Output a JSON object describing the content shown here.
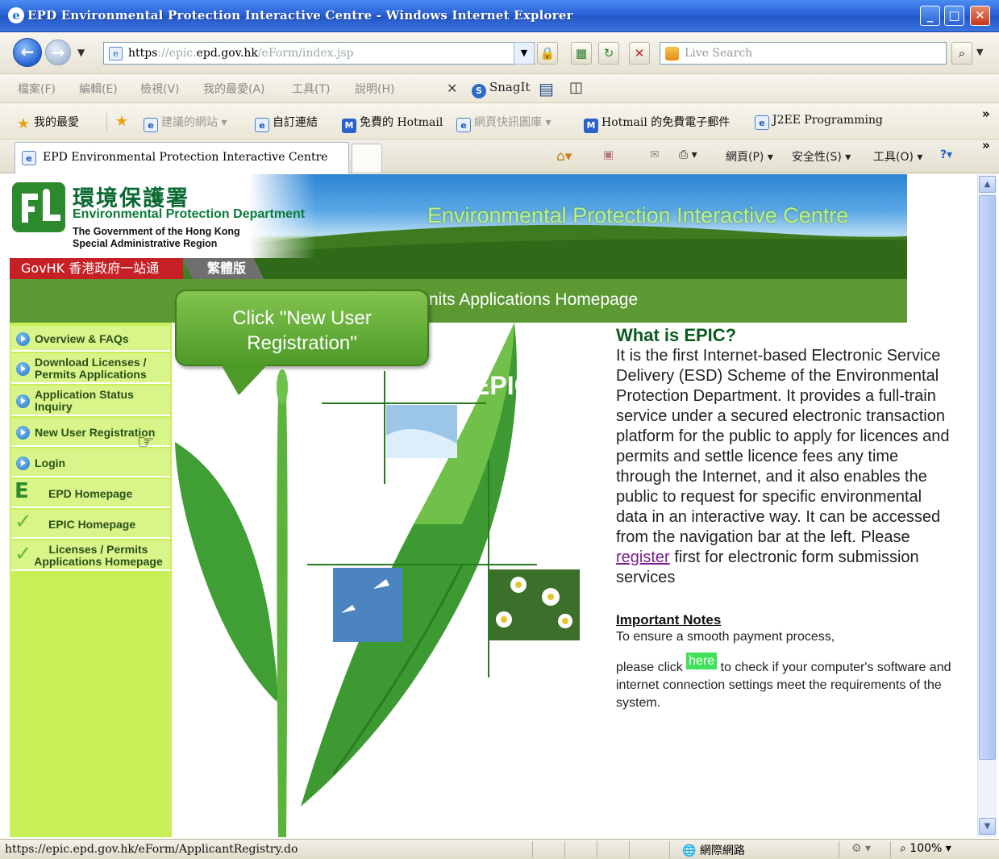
{
  "window": {
    "title": "EPD Environmental Protection Interactive Centre - Windows Internet Explorer"
  },
  "address": {
    "url_scheme": "https",
    "url_host_prefix": "://epic.",
    "url_host": "epd.gov.hk",
    "url_path": "/eForm/index.jsp"
  },
  "search": {
    "placeholder": "Live Search"
  },
  "menu": {
    "items": [
      "檔案(F)",
      "編輯(E)",
      "檢視(V)",
      "我的最愛(A)",
      "工具(T)",
      "說明(H)"
    ],
    "snagit": "SnagIt"
  },
  "favorites": {
    "label": "我的最愛",
    "items": [
      "建議的網站 ▾",
      "自訂連結",
      "免費的 Hotmail",
      "網頁快訊圖庫 ▾",
      "Hotmail 的免費電子郵件",
      "J2EE Programming"
    ]
  },
  "tab": {
    "title": "EPD Environmental Protection Interactive Centre"
  },
  "commandbar": {
    "page": "網頁(P) ▾",
    "safety": "安全性(S) ▾",
    "tools": "工具(O) ▾"
  },
  "header": {
    "zh_name": "環境保護署",
    "en_name": "Environmental Protection Department",
    "govt_line1": "The Government of the Hong Kong",
    "govt_line2": "Special Administrative Region",
    "banner_title": "Environmental Protection Interactive Centre",
    "govhk": "GovHK 香港政府一站通",
    "traditional": "繁體版"
  },
  "section_title": "nits Applications Homepage",
  "callout": {
    "line1": "Click \"New User",
    "line2": "Registration\""
  },
  "sidebar": {
    "items": [
      {
        "label": "Overview & FAQs"
      },
      {
        "label": "Download Licenses /",
        "label2": "Permits Applications"
      },
      {
        "label": "Application Status",
        "label2": "Inquiry"
      },
      {
        "label": "New User Registration"
      },
      {
        "label": "Login"
      },
      {
        "label": "EPD Homepage"
      },
      {
        "label": "EPIC Homepage"
      },
      {
        "label": "Licenses / Permits",
        "label2": "Applications Homepage"
      }
    ]
  },
  "art": {
    "epic_label": "EPIC"
  },
  "info": {
    "heading": "What is EPIC?",
    "body_before": "It is the first Internet-based Electronic Service Delivery (ESD) Scheme of the Environmental Protection Department. It provides a full-train service under a secured electronic transaction platform for the public to apply for licences and permits and settle licence fees any time through the Internet, and it also enables the public to request for specific environmental data in an interactive way. It can be accessed from the navigation bar at the left. Please ",
    "register_link": "register",
    "body_after": " first for electronic form submission services",
    "notes_heading": "Important Notes",
    "notes_line1": "To ensure a smooth payment process,",
    "notes_before": "please click ",
    "here_link": "here",
    "notes_after": " to check if your computer's software and internet connection settings meet the requirements of the system."
  },
  "status": {
    "url": "https://epic.epd.gov.hk/eForm/ApplicantRegistry.do",
    "zone": "網際網路",
    "zoom": "100%"
  },
  "colors": {
    "sidebar_bg": "#c8ee58",
    "header_green": "#5c9933",
    "callout_green": "#6cb43c",
    "title_bar": "#2a62d8"
  }
}
